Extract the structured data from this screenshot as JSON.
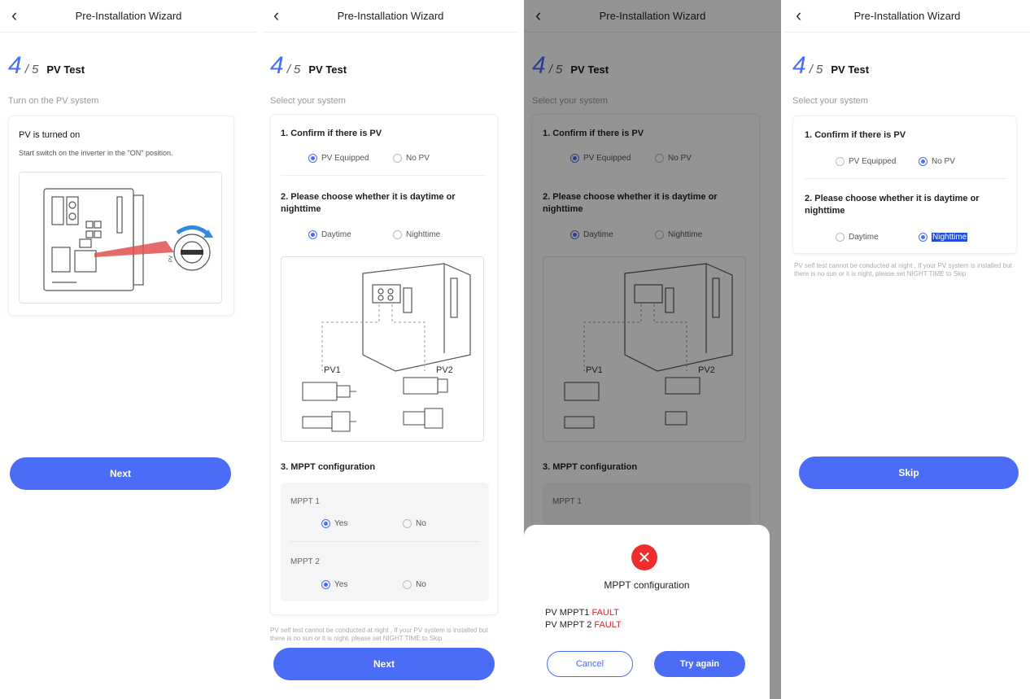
{
  "wizard": {
    "title": "Pre-Installation Wizard",
    "back_icon": "‹",
    "step_current": "4",
    "step_total": "/ 5",
    "step_name": "PV Test"
  },
  "screen1": {
    "subtitle": "Turn on the PV system",
    "card_title": "PV is turned on",
    "card_text": "Start switch on the inverter in the \"ON\" position.",
    "next_label": "Next"
  },
  "screen2": {
    "subtitle": "Select your system",
    "q1": "1. Confirm if there is PV",
    "q1_options": [
      "PV Equipped",
      "No PV"
    ],
    "q2": "2. Please choose whether it is daytime or nighttime",
    "q2_options": [
      "Daytime",
      "Nighttime"
    ],
    "pv_labels": [
      "PV1",
      "PV2"
    ],
    "q3": "3. MPPT configuration",
    "mppt1": "MPPT 1",
    "mppt2": "MPPT 2",
    "mppt_options": [
      "Yes",
      "No"
    ],
    "note": "PV self test cannot be conducted at night , If your PV system is installed but there is no sun or it is night, please set NIGHT TIME to Skip",
    "next_label": "Next"
  },
  "screen3": {
    "sheet_icon": "✕",
    "sheet_title": "MPPT configuration",
    "fault1_label": "PV MPPT1",
    "fault2_label": "PV MPPT 2",
    "fault_value": "FAULT",
    "cancel_label": "Cancel",
    "retry_label": "Try again"
  },
  "screen4": {
    "subtitle": "Select your system",
    "note": "PV self test cannot be conducted at night , If your PV system is installed but there is no sun or it is night, please set NIGHT TIME to Skip",
    "skip_label": "Skip"
  },
  "colors": {
    "accent": "#4a6cf7",
    "fault": "#e02020",
    "error_icon": "#f02d2d"
  }
}
